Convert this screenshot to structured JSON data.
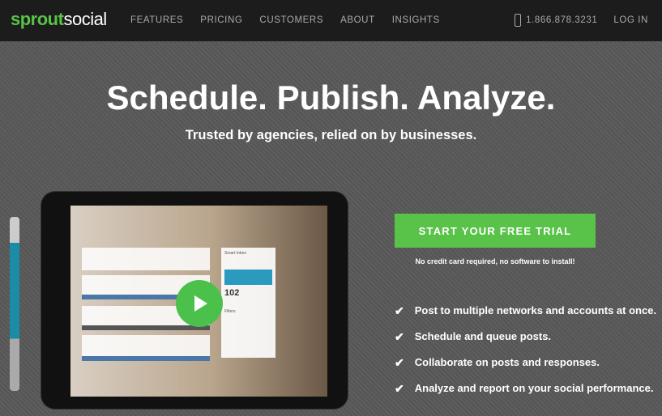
{
  "nav": {
    "logo_a": "sprout",
    "logo_b": "social",
    "links": [
      "FEATURES",
      "PRICING",
      "CUSTOMERS",
      "ABOUT",
      "INSIGHTS"
    ],
    "phone": "1.866.878.3231",
    "login": "LOG IN"
  },
  "hero": {
    "title": "Schedule. Publish. Analyze.",
    "subtitle": "Trusted by agencies, relied on by businesses.",
    "video": {
      "panel_title": "Smart Inbox",
      "count": "102",
      "filters": "Filters"
    },
    "cta": "START YOUR FREE TRIAL",
    "note": "No credit card required, no software to install!",
    "features": [
      "Post to multiple networks and accounts at once.",
      "Schedule and queue posts.",
      "Collaborate on posts and responses.",
      "Analyze and report on your social performance."
    ]
  },
  "colors": {
    "accent": "#59c248",
    "nav_bg": "#1c1c1c"
  }
}
